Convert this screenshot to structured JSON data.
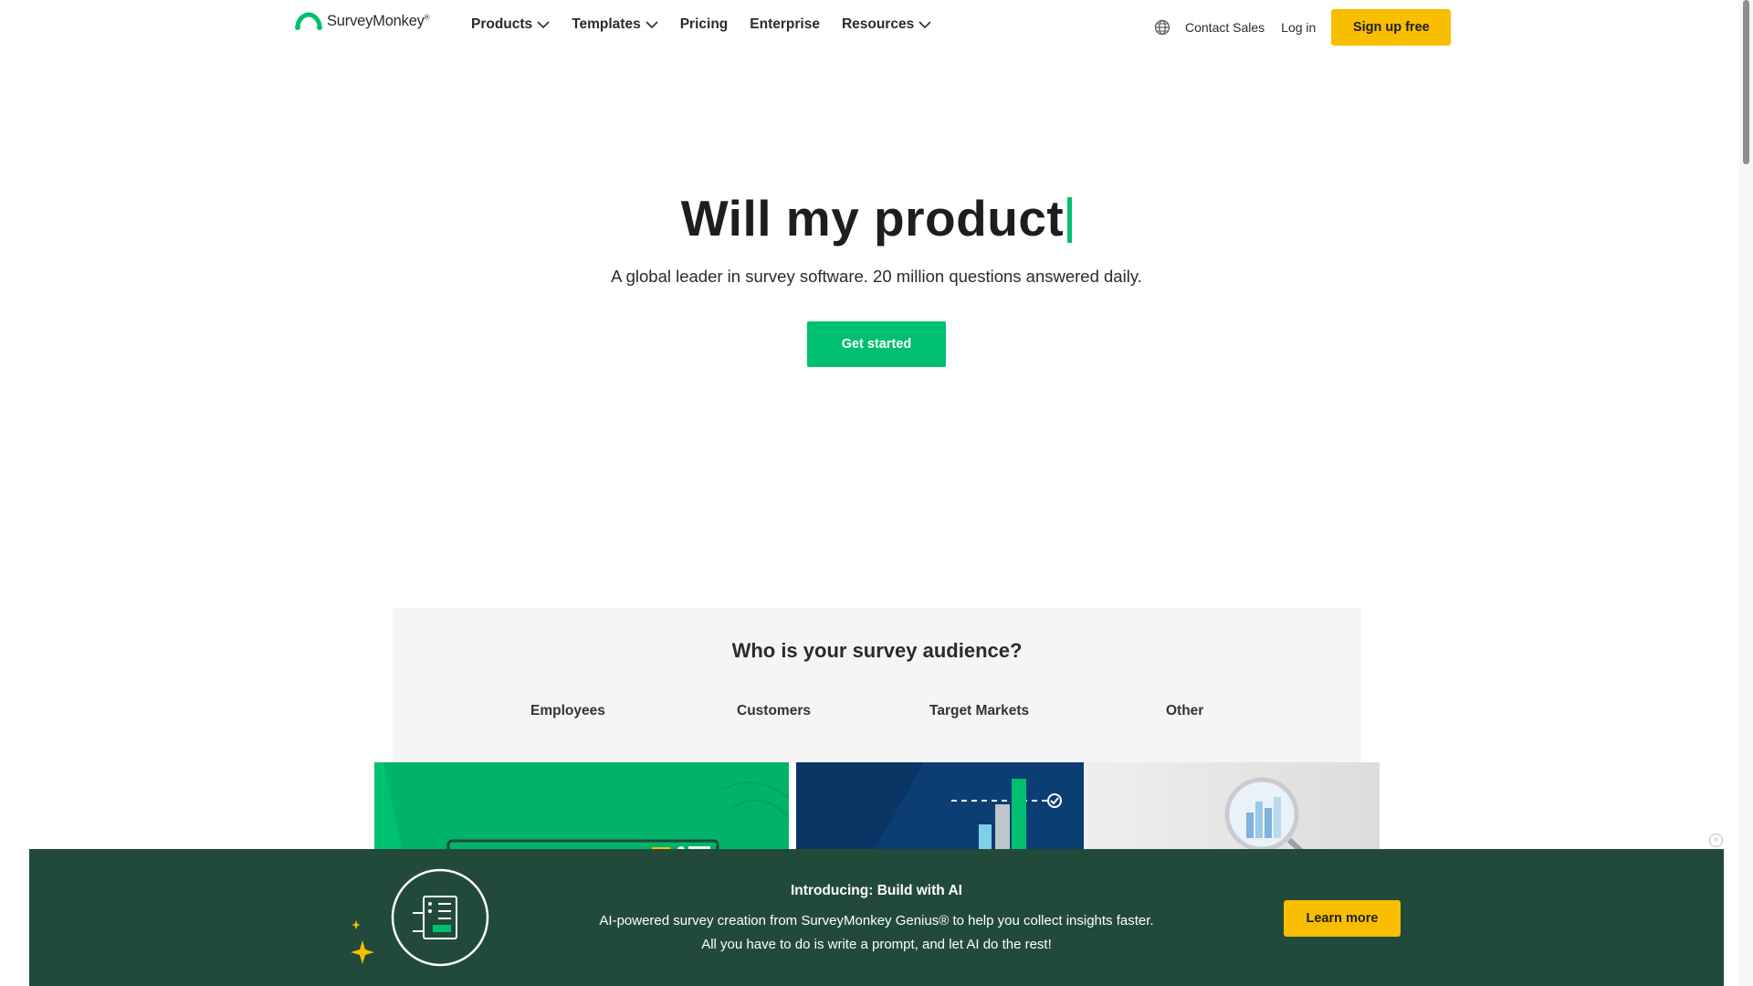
{
  "header": {
    "logo_text": "SurveyMonkey",
    "logo_mark": "®",
    "nav": [
      {
        "label": "Products",
        "has_dropdown": true
      },
      {
        "label": "Templates",
        "has_dropdown": true
      },
      {
        "label": "Pricing",
        "has_dropdown": false
      },
      {
        "label": "Enterprise",
        "has_dropdown": false
      },
      {
        "label": "Resources",
        "has_dropdown": true
      }
    ],
    "globe_icon": "globe-icon",
    "contact_label": "Contact Sales",
    "login_label": "Log in",
    "signup_label": "Sign up free"
  },
  "hero": {
    "title": "Will my product",
    "subtitle": "A global leader in survey software. 20 million questions answered daily.",
    "cta_label": "Get started"
  },
  "audience": {
    "title": "Who is your survey audience?",
    "tabs": [
      "Employees",
      "Customers",
      "Target Markets",
      "Other"
    ]
  },
  "banner": {
    "title": "Introducing: Build with AI",
    "line1": "AI-powered survey creation from SurveyMonkey Genius® to help you collect insights faster.",
    "line2": "All you have to do is write a prompt, and let AI do the rest!",
    "cta_label": "Learn more",
    "close_icon": "close-icon"
  },
  "colors": {
    "brand_green": "#00bf6f",
    "accent_yellow": "#f9be00",
    "banner_bg": "#224a3b",
    "card_blue": "#0c3e73"
  }
}
